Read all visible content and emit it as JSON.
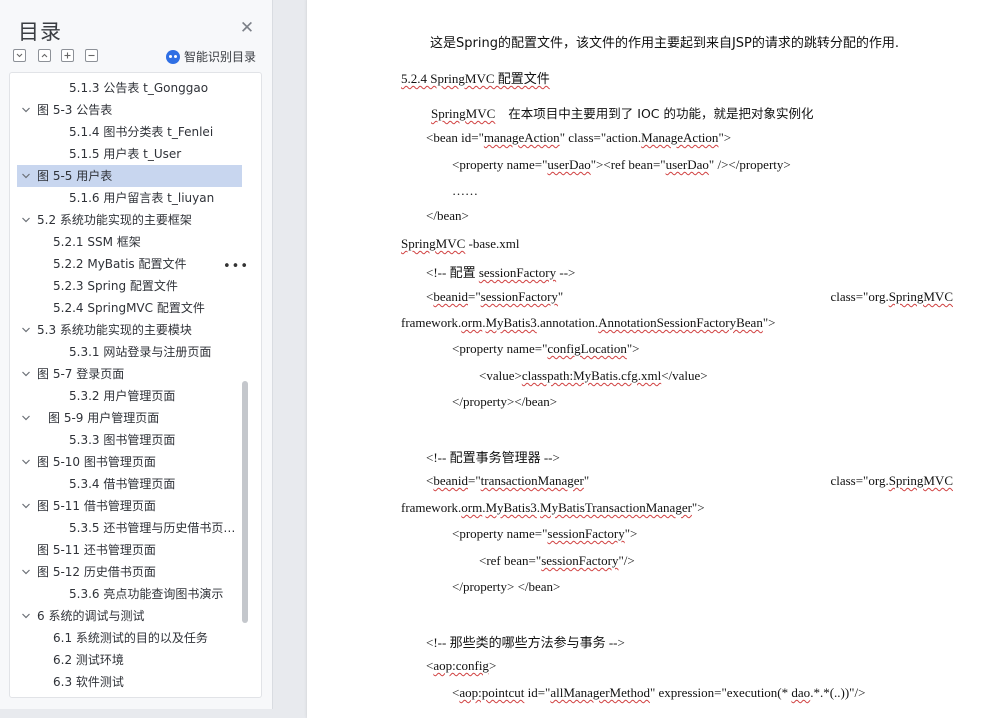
{
  "sidebar": {
    "title": "目录",
    "ai_toc_label": "智能识别目录",
    "more_label": "•••",
    "items": [
      {
        "label": "5.1.3 公告表 t_Gonggao",
        "expandable": false
      },
      {
        "label": "图 5-3 公告表",
        "expandable": true
      },
      {
        "label": "5.1.4 图书分类表 t_Fenlei",
        "expandable": false
      },
      {
        "label": "5.1.5 用户表 t_User",
        "expandable": false
      },
      {
        "label": "图 5-5 用户表",
        "expandable": true,
        "selected": true
      },
      {
        "label": "5.1.6 用户留言表 t_liuyan",
        "expandable": false
      },
      {
        "label": "5.2 系统功能实现的主要框架",
        "expandable": true
      },
      {
        "label": "5.2.1 SSM 框架",
        "expandable": false
      },
      {
        "label": "5.2.2 MyBatis 配置文件",
        "expandable": false
      },
      {
        "label": "5.2.3 Spring 配置文件",
        "expandable": false
      },
      {
        "label": "5.2.4 SpringMVC 配置文件",
        "expandable": false
      },
      {
        "label": "5.3 系统功能实现的主要模块",
        "expandable": true
      },
      {
        "label": "5.3.1 网站登录与注册页面",
        "expandable": false
      },
      {
        "label": "图 5-7 登录页面",
        "expandable": true
      },
      {
        "label": "5.3.2 用户管理页面",
        "expandable": false
      },
      {
        "label": "图 5-9 用户管理页面",
        "expandable": true
      },
      {
        "label": "5.3.3 图书管理页面",
        "expandable": false
      },
      {
        "label": "图 5-10 图书管理页面",
        "expandable": true
      },
      {
        "label": "5.3.4 借书管理页面",
        "expandable": false
      },
      {
        "label": "图 5-11 借书管理页面",
        "expandable": true
      },
      {
        "label": "5.3.5 还书管理与历史借书页…",
        "expandable": false
      },
      {
        "label": "图 5-11 还书管理页面",
        "expandable": false
      },
      {
        "label": "图 5-12 历史借书页面",
        "expandable": true
      },
      {
        "label": "5.3.6 亮点功能查询图书演示",
        "expandable": false
      },
      {
        "label": "6 系统的调试与测试",
        "expandable": true
      },
      {
        "label": "6.1 系统测试的目的以及任务",
        "expandable": false
      },
      {
        "label": "6.2 测试环境",
        "expandable": false
      },
      {
        "label": "6.3 软件测试",
        "expandable": false
      }
    ]
  },
  "document": {
    "intro": "这是Spring的配置文件，该文件的作用主要起到来自JSP的请求的跳转分配的作用.",
    "heading": "5.2.4 SpringMVC 配置文件",
    "para_a": "SpringMVC",
    "para_b": "在本项目中主要用到了 IOC 的功能，就是把对象实例化",
    "code1": "<bean id=\"manageAction\"    class=\"action.ManageAction\">",
    "code2": "<property name=\"userDao\"><ref bean=\"userDao\" /></property>",
    "code3": "……",
    "code4": "</bean>",
    "file_name": "SpringMVC -base.xml",
    "c1": "<!-- 配置 sessionFactory -->",
    "c2_left": "<beanid=\"sessionFactory\"",
    "c2_right": "class=\"org.SpringMVC",
    "c3": "framework.orm.MyBatis3.annotation.AnnotationSessionFactoryBean\">",
    "c4": "<property name=\"configLocation\">",
    "c5": "<value>classpath:MyBatis.cfg.xml</value>",
    "c6": "</property></bean>",
    "c7": "<!-- 配置事务管理器 -->",
    "c8_left": "<beanid=\"transactionManager\"",
    "c8_right": "class=\"org.SpringMVC",
    "c9": "framework.orm.MyBatis3.MyBatisTransactionManager\">",
    "c10": "<property name=\"sessionFactory\">",
    "c11": "<ref bean=\"sessionFactory\"/>",
    "c12": "</property>  </bean>",
    "c13": "<!-- 那些类的哪些方法参与事务 -->",
    "c14": "<aop:config>",
    "c15": "<aop:pointcut id=\"allManagerMethod\" expression=\"execution(* dao.*.*(..))\"/>"
  },
  "colors": {
    "selected_bg": "#c8d6ef",
    "ai_icon": "#2f6fe4",
    "spell_underline": "#d04040"
  },
  "icons": [
    "close-icon",
    "expand-all-icon",
    "collapse-all-icon",
    "plus-icon",
    "minus-icon",
    "ai-icon",
    "chevron-down-icon"
  ]
}
